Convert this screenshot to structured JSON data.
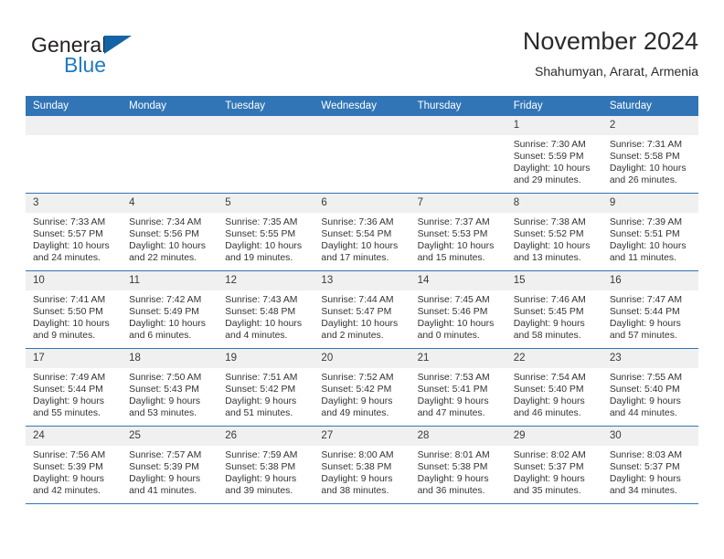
{
  "brand": {
    "word_one": "General",
    "word_two": "Blue",
    "logo_icon": "triangle-logo-icon"
  },
  "header": {
    "title": "November 2024",
    "subtitle": "Shahumyan, Ararat, Armenia"
  },
  "colors": {
    "header_blue": "#3175b6",
    "daynum_gray": "#f0f0f0",
    "brand_blue": "#1f7ac4",
    "logo_blue": "#1464a5"
  },
  "weekday_headers": [
    "Sunday",
    "Monday",
    "Tuesday",
    "Wednesday",
    "Thursday",
    "Friday",
    "Saturday"
  ],
  "weeks": [
    [
      {
        "day": "",
        "empty": true
      },
      {
        "day": "",
        "empty": true
      },
      {
        "day": "",
        "empty": true
      },
      {
        "day": "",
        "empty": true
      },
      {
        "day": "",
        "empty": true
      },
      {
        "day": "1",
        "sunrise": "Sunrise: 7:30 AM",
        "sunset": "Sunset: 5:59 PM",
        "daylight_1": "Daylight: 10 hours",
        "daylight_2": "and 29 minutes."
      },
      {
        "day": "2",
        "sunrise": "Sunrise: 7:31 AM",
        "sunset": "Sunset: 5:58 PM",
        "daylight_1": "Daylight: 10 hours",
        "daylight_2": "and 26 minutes."
      }
    ],
    [
      {
        "day": "3",
        "sunrise": "Sunrise: 7:33 AM",
        "sunset": "Sunset: 5:57 PM",
        "daylight_1": "Daylight: 10 hours",
        "daylight_2": "and 24 minutes."
      },
      {
        "day": "4",
        "sunrise": "Sunrise: 7:34 AM",
        "sunset": "Sunset: 5:56 PM",
        "daylight_1": "Daylight: 10 hours",
        "daylight_2": "and 22 minutes."
      },
      {
        "day": "5",
        "sunrise": "Sunrise: 7:35 AM",
        "sunset": "Sunset: 5:55 PM",
        "daylight_1": "Daylight: 10 hours",
        "daylight_2": "and 19 minutes."
      },
      {
        "day": "6",
        "sunrise": "Sunrise: 7:36 AM",
        "sunset": "Sunset: 5:54 PM",
        "daylight_1": "Daylight: 10 hours",
        "daylight_2": "and 17 minutes."
      },
      {
        "day": "7",
        "sunrise": "Sunrise: 7:37 AM",
        "sunset": "Sunset: 5:53 PM",
        "daylight_1": "Daylight: 10 hours",
        "daylight_2": "and 15 minutes."
      },
      {
        "day": "8",
        "sunrise": "Sunrise: 7:38 AM",
        "sunset": "Sunset: 5:52 PM",
        "daylight_1": "Daylight: 10 hours",
        "daylight_2": "and 13 minutes."
      },
      {
        "day": "9",
        "sunrise": "Sunrise: 7:39 AM",
        "sunset": "Sunset: 5:51 PM",
        "daylight_1": "Daylight: 10 hours",
        "daylight_2": "and 11 minutes."
      }
    ],
    [
      {
        "day": "10",
        "sunrise": "Sunrise: 7:41 AM",
        "sunset": "Sunset: 5:50 PM",
        "daylight_1": "Daylight: 10 hours",
        "daylight_2": "and 9 minutes."
      },
      {
        "day": "11",
        "sunrise": "Sunrise: 7:42 AM",
        "sunset": "Sunset: 5:49 PM",
        "daylight_1": "Daylight: 10 hours",
        "daylight_2": "and 6 minutes."
      },
      {
        "day": "12",
        "sunrise": "Sunrise: 7:43 AM",
        "sunset": "Sunset: 5:48 PM",
        "daylight_1": "Daylight: 10 hours",
        "daylight_2": "and 4 minutes."
      },
      {
        "day": "13",
        "sunrise": "Sunrise: 7:44 AM",
        "sunset": "Sunset: 5:47 PM",
        "daylight_1": "Daylight: 10 hours",
        "daylight_2": "and 2 minutes."
      },
      {
        "day": "14",
        "sunrise": "Sunrise: 7:45 AM",
        "sunset": "Sunset: 5:46 PM",
        "daylight_1": "Daylight: 10 hours",
        "daylight_2": "and 0 minutes."
      },
      {
        "day": "15",
        "sunrise": "Sunrise: 7:46 AM",
        "sunset": "Sunset: 5:45 PM",
        "daylight_1": "Daylight: 9 hours",
        "daylight_2": "and 58 minutes."
      },
      {
        "day": "16",
        "sunrise": "Sunrise: 7:47 AM",
        "sunset": "Sunset: 5:44 PM",
        "daylight_1": "Daylight: 9 hours",
        "daylight_2": "and 57 minutes."
      }
    ],
    [
      {
        "day": "17",
        "sunrise": "Sunrise: 7:49 AM",
        "sunset": "Sunset: 5:44 PM",
        "daylight_1": "Daylight: 9 hours",
        "daylight_2": "and 55 minutes."
      },
      {
        "day": "18",
        "sunrise": "Sunrise: 7:50 AM",
        "sunset": "Sunset: 5:43 PM",
        "daylight_1": "Daylight: 9 hours",
        "daylight_2": "and 53 minutes."
      },
      {
        "day": "19",
        "sunrise": "Sunrise: 7:51 AM",
        "sunset": "Sunset: 5:42 PM",
        "daylight_1": "Daylight: 9 hours",
        "daylight_2": "and 51 minutes."
      },
      {
        "day": "20",
        "sunrise": "Sunrise: 7:52 AM",
        "sunset": "Sunset: 5:42 PM",
        "daylight_1": "Daylight: 9 hours",
        "daylight_2": "and 49 minutes."
      },
      {
        "day": "21",
        "sunrise": "Sunrise: 7:53 AM",
        "sunset": "Sunset: 5:41 PM",
        "daylight_1": "Daylight: 9 hours",
        "daylight_2": "and 47 minutes."
      },
      {
        "day": "22",
        "sunrise": "Sunrise: 7:54 AM",
        "sunset": "Sunset: 5:40 PM",
        "daylight_1": "Daylight: 9 hours",
        "daylight_2": "and 46 minutes."
      },
      {
        "day": "23",
        "sunrise": "Sunrise: 7:55 AM",
        "sunset": "Sunset: 5:40 PM",
        "daylight_1": "Daylight: 9 hours",
        "daylight_2": "and 44 minutes."
      }
    ],
    [
      {
        "day": "24",
        "sunrise": "Sunrise: 7:56 AM",
        "sunset": "Sunset: 5:39 PM",
        "daylight_1": "Daylight: 9 hours",
        "daylight_2": "and 42 minutes."
      },
      {
        "day": "25",
        "sunrise": "Sunrise: 7:57 AM",
        "sunset": "Sunset: 5:39 PM",
        "daylight_1": "Daylight: 9 hours",
        "daylight_2": "and 41 minutes."
      },
      {
        "day": "26",
        "sunrise": "Sunrise: 7:59 AM",
        "sunset": "Sunset: 5:38 PM",
        "daylight_1": "Daylight: 9 hours",
        "daylight_2": "and 39 minutes."
      },
      {
        "day": "27",
        "sunrise": "Sunrise: 8:00 AM",
        "sunset": "Sunset: 5:38 PM",
        "daylight_1": "Daylight: 9 hours",
        "daylight_2": "and 38 minutes."
      },
      {
        "day": "28",
        "sunrise": "Sunrise: 8:01 AM",
        "sunset": "Sunset: 5:38 PM",
        "daylight_1": "Daylight: 9 hours",
        "daylight_2": "and 36 minutes."
      },
      {
        "day": "29",
        "sunrise": "Sunrise: 8:02 AM",
        "sunset": "Sunset: 5:37 PM",
        "daylight_1": "Daylight: 9 hours",
        "daylight_2": "and 35 minutes."
      },
      {
        "day": "30",
        "sunrise": "Sunrise: 8:03 AM",
        "sunset": "Sunset: 5:37 PM",
        "daylight_1": "Daylight: 9 hours",
        "daylight_2": "and 34 minutes."
      }
    ]
  ]
}
